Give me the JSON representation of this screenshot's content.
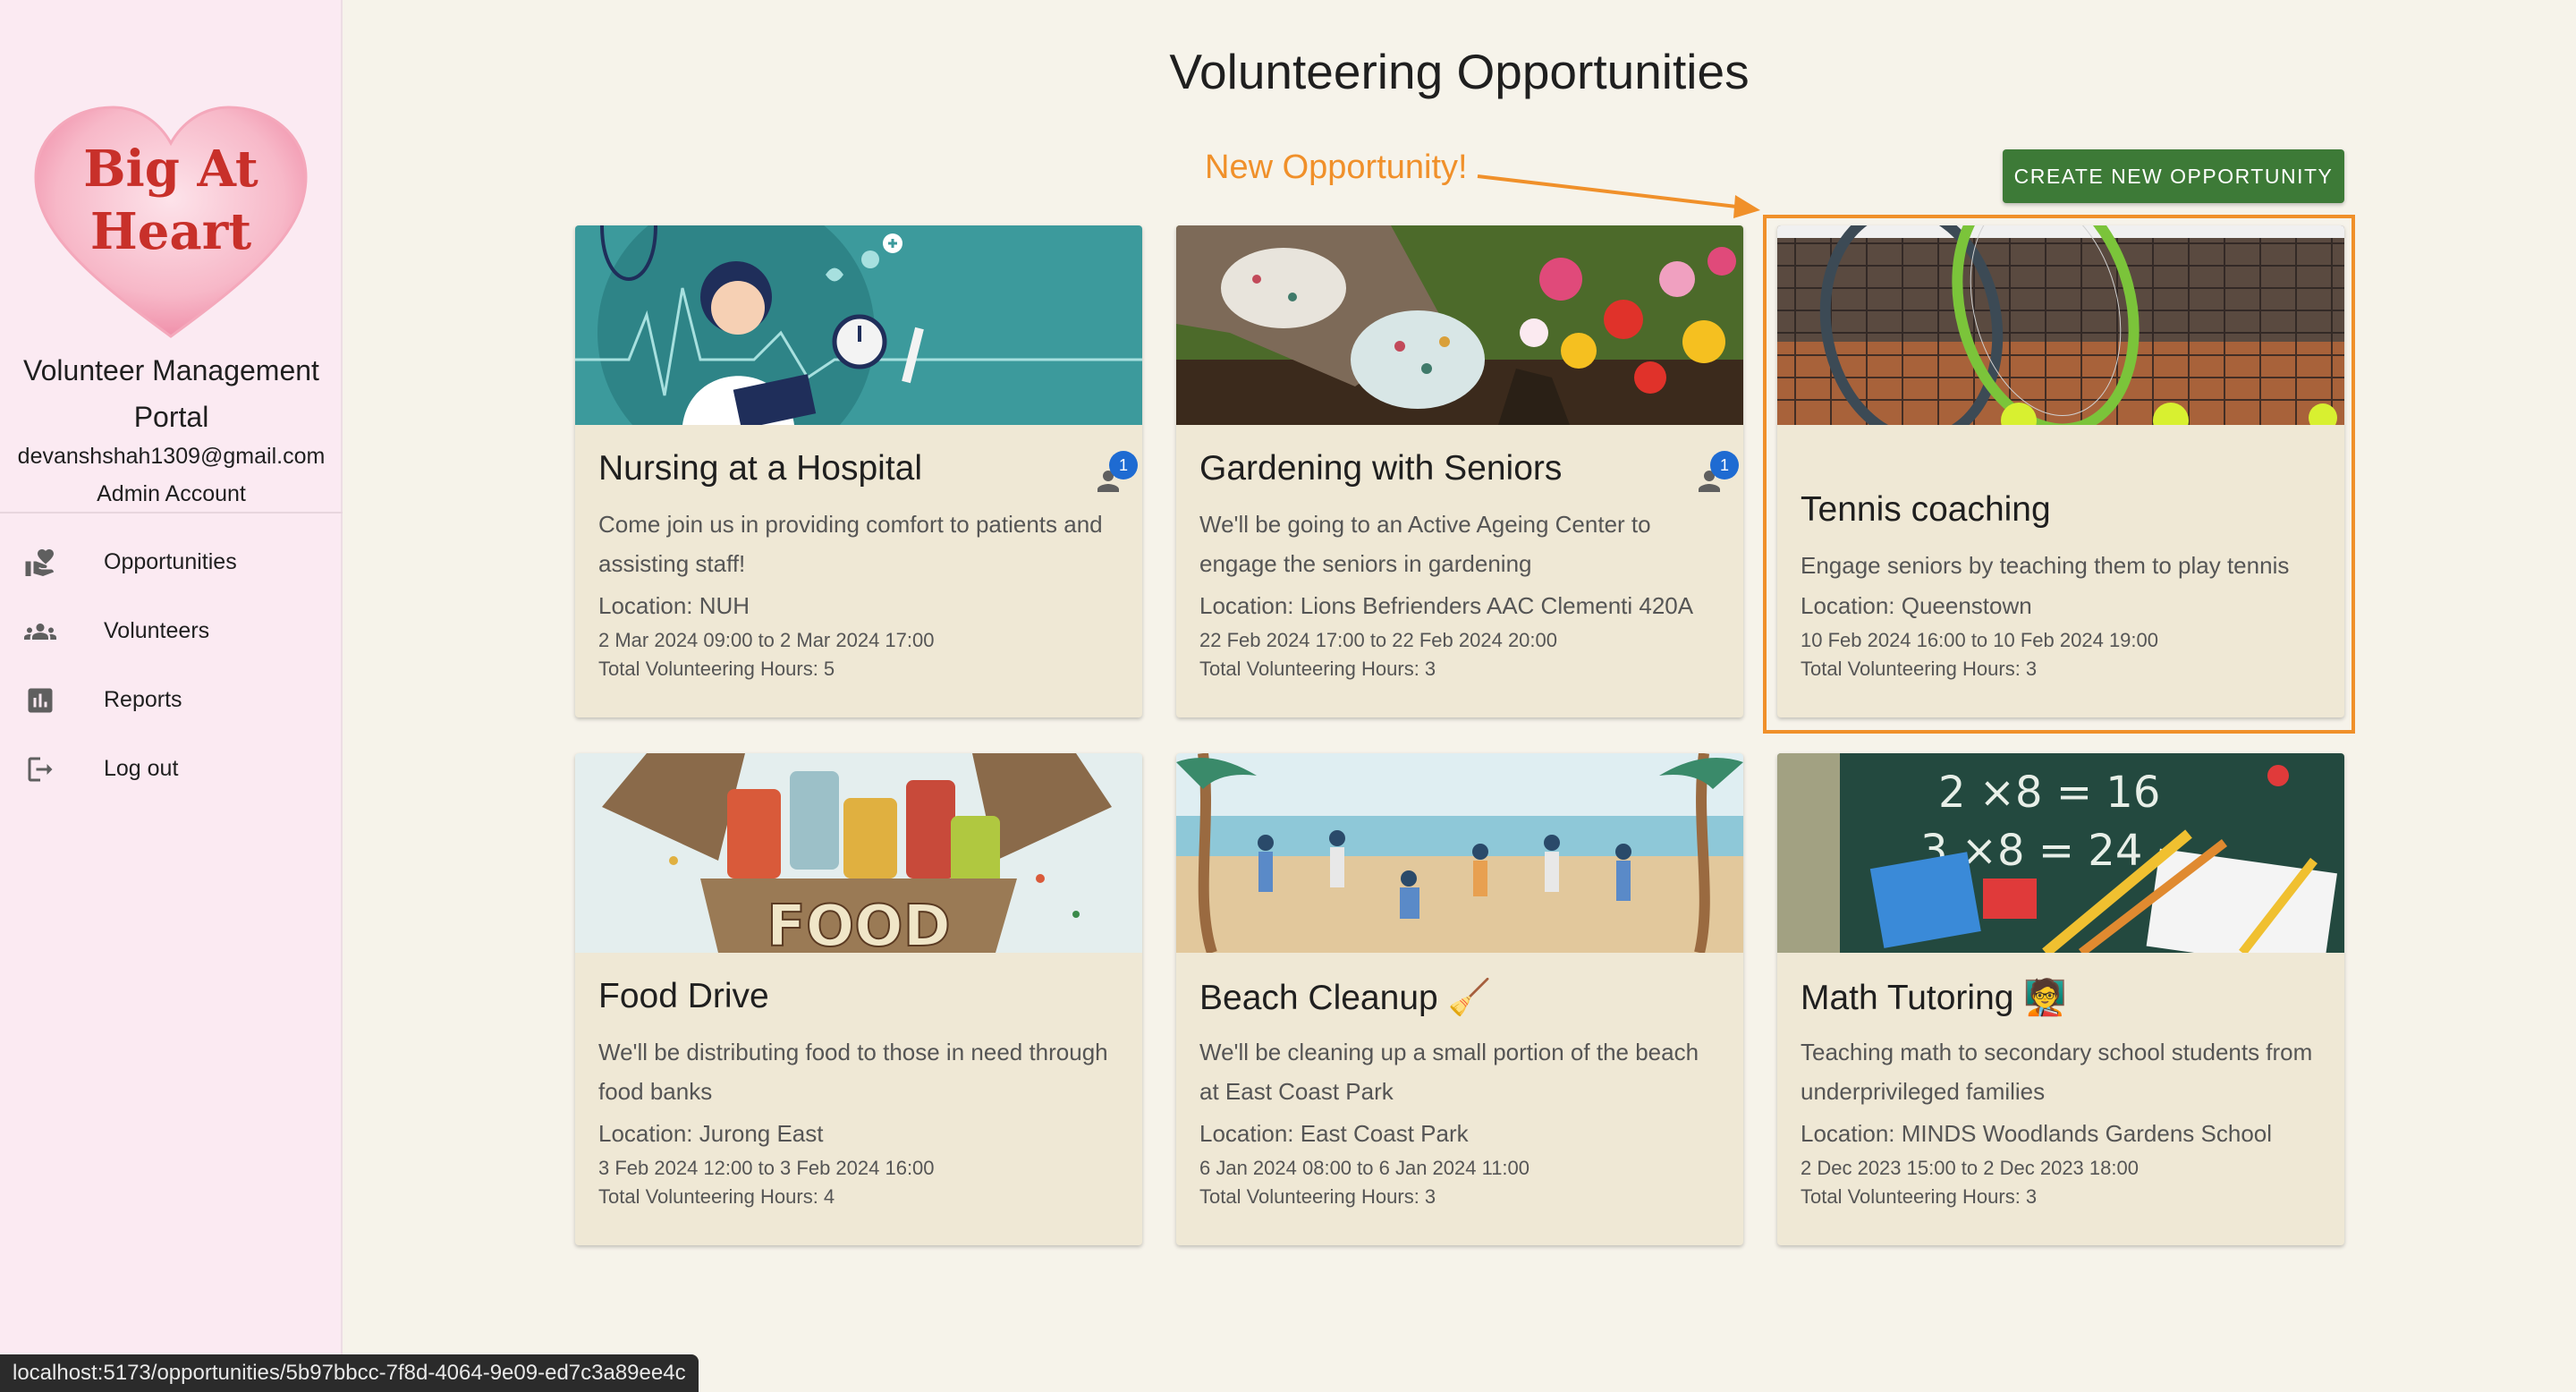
{
  "sidebar": {
    "logo_line1": "Big At",
    "logo_line2": "Heart",
    "portal_title": "Volunteer Management Portal",
    "email": "devanshshah1309@gmail.com",
    "account": "Admin Account",
    "nav": [
      {
        "label": "Opportunities",
        "icon": "volunteer-hand-heart-icon"
      },
      {
        "label": "Volunteers",
        "icon": "people-icon"
      },
      {
        "label": "Reports",
        "icon": "bar-chart-icon"
      },
      {
        "label": "Log out",
        "icon": "logout-icon"
      }
    ]
  },
  "main": {
    "title": "Volunteering Opportunities",
    "annotation": "New Opportunity!",
    "create_button": "CREATE NEW OPPORTUNITY",
    "colors": {
      "accent": "#f0902a",
      "button": "#3d7a37",
      "badge": "#1e6bd2",
      "card": "#efe8d5"
    }
  },
  "cards": [
    {
      "title": "Nursing at a Hospital",
      "desc": "Come join us in providing comfort to patients and assisting staff!",
      "location": "Location: NUH",
      "date": "2 Mar 2024 09:00 to 2 Mar 2024 17:00",
      "hours": "Total Volunteering Hours: 5",
      "badge": "1",
      "image": "nurse-illustration"
    },
    {
      "title": "Gardening with Seniors",
      "desc": "We'll be going to an Active Ageing Center to engage the seniors in gardening",
      "location": "Location: Lions Befrienders AAC Clementi 420A",
      "date": "22 Feb 2024 17:00 to 22 Feb 2024 20:00",
      "hours": "Total Volunteering Hours: 3",
      "badge": "1",
      "image": "gardening-photo"
    },
    {
      "title": "Tennis coaching",
      "desc": "Engage seniors by teaching them to play tennis",
      "location": "Location: Queenstown",
      "date": "10 Feb 2024 16:00 to 10 Feb 2024 19:00",
      "hours": "Total Volunteering Hours: 3",
      "image": "tennis-photo"
    },
    {
      "title": "Food Drive",
      "desc": "We'll be distributing food to those in need through food banks",
      "location": "Location: Jurong East",
      "date": "3 Feb 2024 12:00 to 3 Feb 2024 16:00",
      "hours": "Total Volunteering Hours: 4",
      "image_text": "FOOD",
      "image": "food-box-illustration"
    },
    {
      "title": "Beach Cleanup 🧹",
      "desc": "We'll be cleaning up a small portion of the beach at East Coast Park",
      "location": "Location: East Coast Park",
      "date": "6 Jan 2024 08:00 to 6 Jan 2024 11:00",
      "hours": "Total Volunteering Hours: 3",
      "image": "beach-cleanup-illustration"
    },
    {
      "title": "Math Tutoring 🧑‍🏫",
      "desc": "Teaching math to secondary school students from underprivileged families",
      "location": "Location: MINDS Woodlands Gardens School",
      "date": "2 Dec 2023 15:00 to 2 Dec 2023 18:00",
      "hours": "Total Volunteering Hours: 3",
      "image_text_1": "2 ×8 = 16",
      "image_text_2": "3 ×8 = 24",
      "image": "math-chalkboard-photo"
    }
  ],
  "statusbar": {
    "url": "localhost:5173/opportunities/5b97bbcc-7f8d-4064-9e09-ed7c3a89ee4c"
  }
}
